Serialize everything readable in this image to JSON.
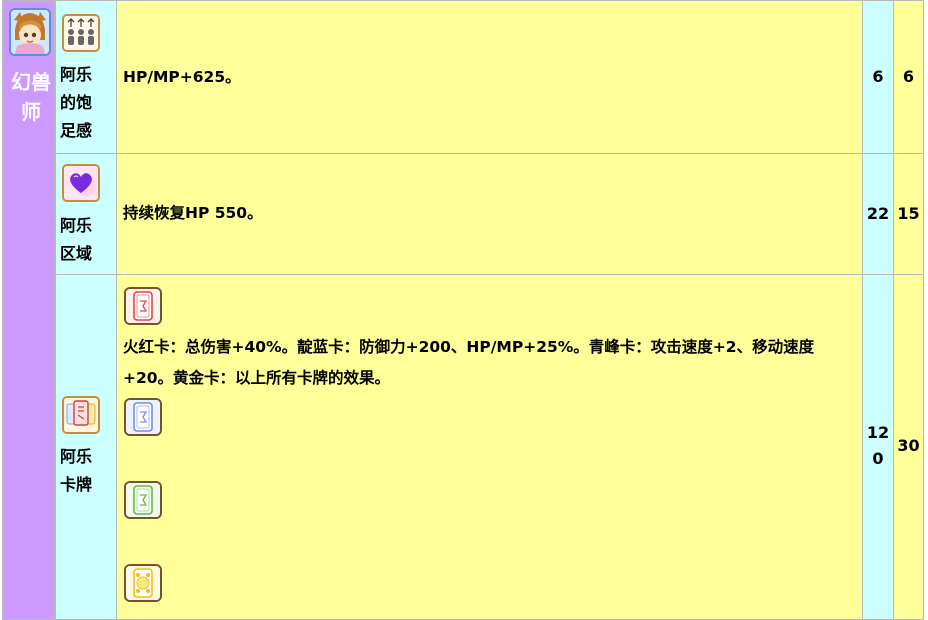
{
  "class": {
    "name": "幻兽师",
    "name_line1": "幻兽",
    "name_line2": "师",
    "portrait_icon": "class-portrait-icon"
  },
  "colors": {
    "class_bg": "#cc99ff",
    "name_col_bg": "#ccffff",
    "desc_col_bg": "#ffff99",
    "border": "#b9b9b9"
  },
  "skills": [
    {
      "name": "阿乐的饱足感",
      "name_lines": [
        "阿乐",
        "的饱",
        "足感"
      ],
      "icon": "crowd-arrows-icon",
      "description": "HP/MP+625。",
      "col_a": "6",
      "col_b": "6"
    },
    {
      "name": "阿乐区域",
      "name_lines": [
        "阿乐",
        "区域"
      ],
      "icon": "heart-zone-icon",
      "description": "持续恢复HP 550。",
      "col_a": "22",
      "col_b": "15"
    },
    {
      "name": "阿乐卡牌",
      "name_lines": [
        "阿乐",
        "卡牌"
      ],
      "icon": "card-icon",
      "description_line1": "火红卡：总伤害+40%。靛蓝卡：防御力+200、HP/MP+25%。青峰卡：攻击速度+2、移动速度",
      "description_line2": "+20。黄金卡：以上所有卡牌的效果。",
      "col_a_line1": "12",
      "col_a_line2": "0",
      "col_b": "30",
      "cards": [
        {
          "icon": "red-card-icon",
          "color": "#e04848"
        },
        {
          "icon": "blue-card-icon",
          "color": "#6f8fe8"
        },
        {
          "icon": "green-card-icon",
          "color": "#5cbf3a"
        },
        {
          "icon": "gold-card-icon",
          "color": "#f0c010"
        }
      ]
    }
  ]
}
